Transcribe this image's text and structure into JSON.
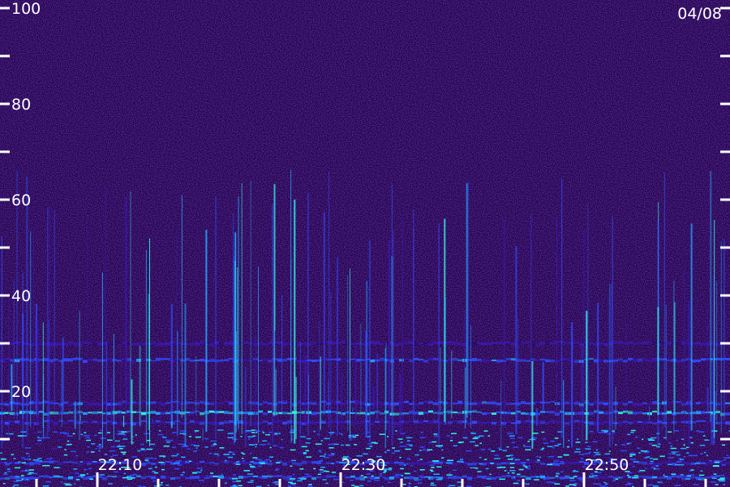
{
  "chart_data": {
    "type": "heatmap",
    "title": "",
    "xlabel": "",
    "ylabel": "",
    "date": "04/08",
    "y_range": [
      0,
      100
    ],
    "y_major_ticks": [
      {
        "value": 20,
        "label": "20"
      },
      {
        "value": 40,
        "label": "40"
      },
      {
        "value": 60,
        "label": "60"
      },
      {
        "value": 80,
        "label": "80"
      },
      {
        "value": 100,
        "label": "100"
      }
    ],
    "y_minor_ticks": [
      10,
      30,
      50,
      70,
      90
    ],
    "x_range": [
      "22:02",
      "23:02"
    ],
    "x_major_ticks": [
      {
        "value": "22:10",
        "label": "22:10"
      },
      {
        "value": "22:30",
        "label": "22:30"
      },
      {
        "value": "22:50",
        "label": "22:50"
      }
    ],
    "x_minor_ticks": [
      "22:05",
      "22:15",
      "22:20",
      "22:25",
      "22:35",
      "22:40",
      "22:45",
      "22:55",
      "23:00"
    ],
    "colormap": [
      "#1a0040",
      "#2a0a6e",
      "#3b18b4",
      "#2f4cff",
      "#1fa8ff",
      "#2ff0e0",
      "#b8ff9a"
    ],
    "background_level": 0.18,
    "bands": [
      {
        "y": 15.5,
        "intensity": 0.82
      },
      {
        "y": 17.5,
        "intensity": 0.55
      },
      {
        "y": 13.5,
        "intensity": 0.5
      },
      {
        "y": 26.5,
        "intensity": 0.55
      },
      {
        "y": 30,
        "intensity": 0.35
      },
      {
        "y": 5,
        "intensity": 0.5
      },
      {
        "y": 2,
        "intensity": 0.6
      }
    ]
  }
}
